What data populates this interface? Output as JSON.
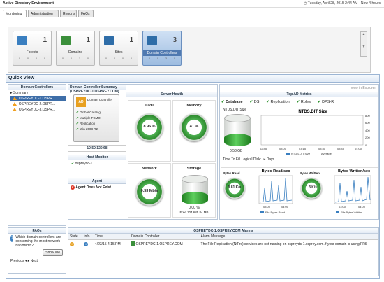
{
  "app": {
    "title": "Active Directory Environment",
    "date_range": "Tuesday, April 28, 2015 2:44 AM - Now 4 hours"
  },
  "tabs": [
    "Monitoring",
    "Administration",
    "Reports",
    "FAQs"
  ],
  "cards": [
    {
      "label": "Forests",
      "count": "1",
      "stats": [
        "0",
        "0",
        "0",
        "0"
      ],
      "color": "#3a7fc0"
    },
    {
      "label": "Domains",
      "count": "1",
      "stats": [
        "0",
        "0",
        "1",
        "0"
      ],
      "color": "#3b8f3b"
    },
    {
      "label": "Sites",
      "count": "1",
      "stats": [
        "0",
        "0",
        "0",
        "0"
      ],
      "color": "#2e6da8"
    },
    {
      "label": "Domain Controllers",
      "count": "3",
      "stats": [
        "0",
        "0",
        "3",
        "0"
      ],
      "color": "#2e6da8"
    }
  ],
  "quickview": {
    "title": "Quick View"
  },
  "dc_panel": {
    "title": "Domain Controllers",
    "summary": "Summary",
    "items": [
      "OSPREYDC-1.OSPR...",
      "OSPREYDC-2.OSPR...",
      "OSPREYDC-3.OSPR..."
    ]
  },
  "summary": {
    "title": "Domain Controller Summary (OSPREYDC-1.OSPREY.COM)",
    "view_explorer": "view in Explorer",
    "dc_name": "OSPREYDC-1.OSPREY.COM",
    "dc_badge": "AD",
    "dc_role": "Domain Controller",
    "roles": [
      "Global Catalog",
      "Multiple FSMO",
      "Replication",
      "Win 2008 R2"
    ],
    "ip": "10.50.120.68"
  },
  "host_monitor": {
    "title": "Host Monitor",
    "host": "ospreydc-1"
  },
  "agent": {
    "title": "Agent",
    "status": "Agent Does Not Exist"
  },
  "server_health": {
    "title": "Server Health",
    "cpu": {
      "label": "CPU",
      "value": "8.96 %"
    },
    "memory": {
      "label": "Memory",
      "value": "41 %"
    },
    "network": {
      "label": "Network",
      "value": "0.53 Mb/s"
    },
    "storage": {
      "label": "Storage",
      "value": "0.00 %",
      "free": "Free 104,685.84 MB"
    }
  },
  "ad_metrics": {
    "title": "Top AD Metrics",
    "tabs": [
      "Database",
      "DS",
      "Replication",
      "Roles",
      "DPS-R"
    ],
    "ntds_label": "NTDS.DIT Size",
    "ntds_value": "0.58 GB",
    "ntds_chart_title": "NTDS.DIT Size",
    "ntds_yticks": [
      "800",
      "600",
      "400",
      "200",
      "0"
    ],
    "ntds_xticks": [
      "02:45",
      "03:00",
      "03:15",
      "03:30",
      "03:45",
      "04:00"
    ],
    "ntds_legend": [
      "NTDS.DIT Size",
      "Average"
    ],
    "time_to_fill": "Time To Fill Logical Disk:",
    "time_to_fill_val": "∞ Days",
    "bytes_read": {
      "label": "Bytes Read",
      "value": "0.81 K/s",
      "chart_title": "Bytes Read/sec",
      "legend": "File Bytes Read..."
    },
    "bytes_written": {
      "label": "Bytes Written",
      "value": "1.3 K/s",
      "chart_title": "Bytes Written/sec",
      "legend": "File Bytes Written"
    },
    "small_xticks": [
      "03:00",
      "04:00"
    ]
  },
  "faqs": {
    "title": "FAQs",
    "question": "Which domain controllers are consuming the most network bandwidth?",
    "show_me": "Show Me",
    "previous": "Previous",
    "next": "Next"
  },
  "alarms": {
    "title": "OSPREYDC-1.OSPREY.COM Alarms",
    "columns": [
      "State",
      "Info",
      "Time",
      "Domain Controller",
      "Alarm Message"
    ],
    "rows": [
      {
        "time": "4/23/15 4:15 PM",
        "dc": "OSPREYDC-1.OSPREY.COM",
        "msg": "The File Replication (NtFrs) services are not running on ospreydc-1.osprey.com.If your domain is using FRS"
      }
    ]
  }
}
